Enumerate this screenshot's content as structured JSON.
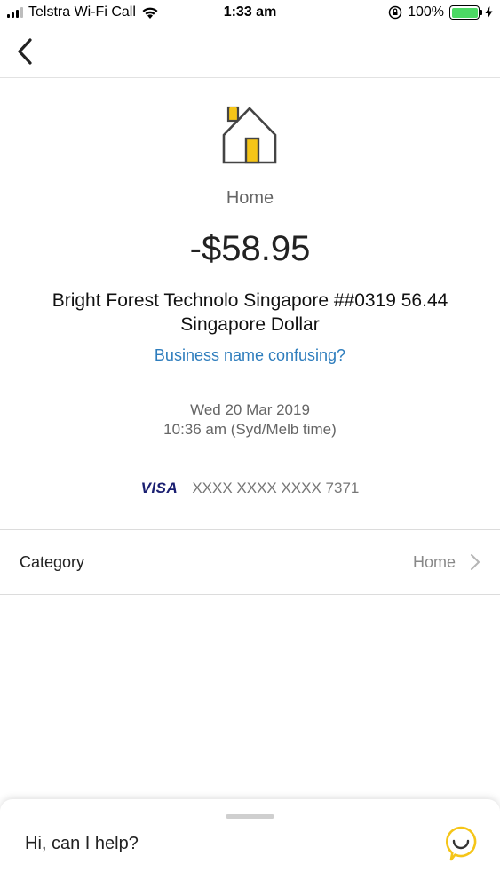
{
  "status_bar": {
    "carrier": "Telstra Wi-Fi Call",
    "time": "1:33 am",
    "battery": "100%"
  },
  "nav": {
    "back_icon": "chevron-left-icon"
  },
  "transaction": {
    "category_icon": "house-icon",
    "category": "Home",
    "amount": "-$58.95",
    "merchant": "Bright Forest Technolo Singapore ##0319 56.44 Singapore Dollar",
    "confusing_link": "Business name confusing?",
    "date": "Wed 20 Mar 2019",
    "time": "10:36 am (Syd/Melb time)",
    "card_brand": "VISA",
    "card_number": "XXXX XXXX XXXX 7371"
  },
  "category_row": {
    "label": "Category",
    "value": "Home"
  },
  "chat": {
    "prompt": "Hi, can I help?"
  },
  "colors": {
    "accent_yellow": "#f5c518",
    "link_blue": "#2e7dbd",
    "visa_blue": "#1a1f71",
    "battery_green": "#4cd964"
  }
}
